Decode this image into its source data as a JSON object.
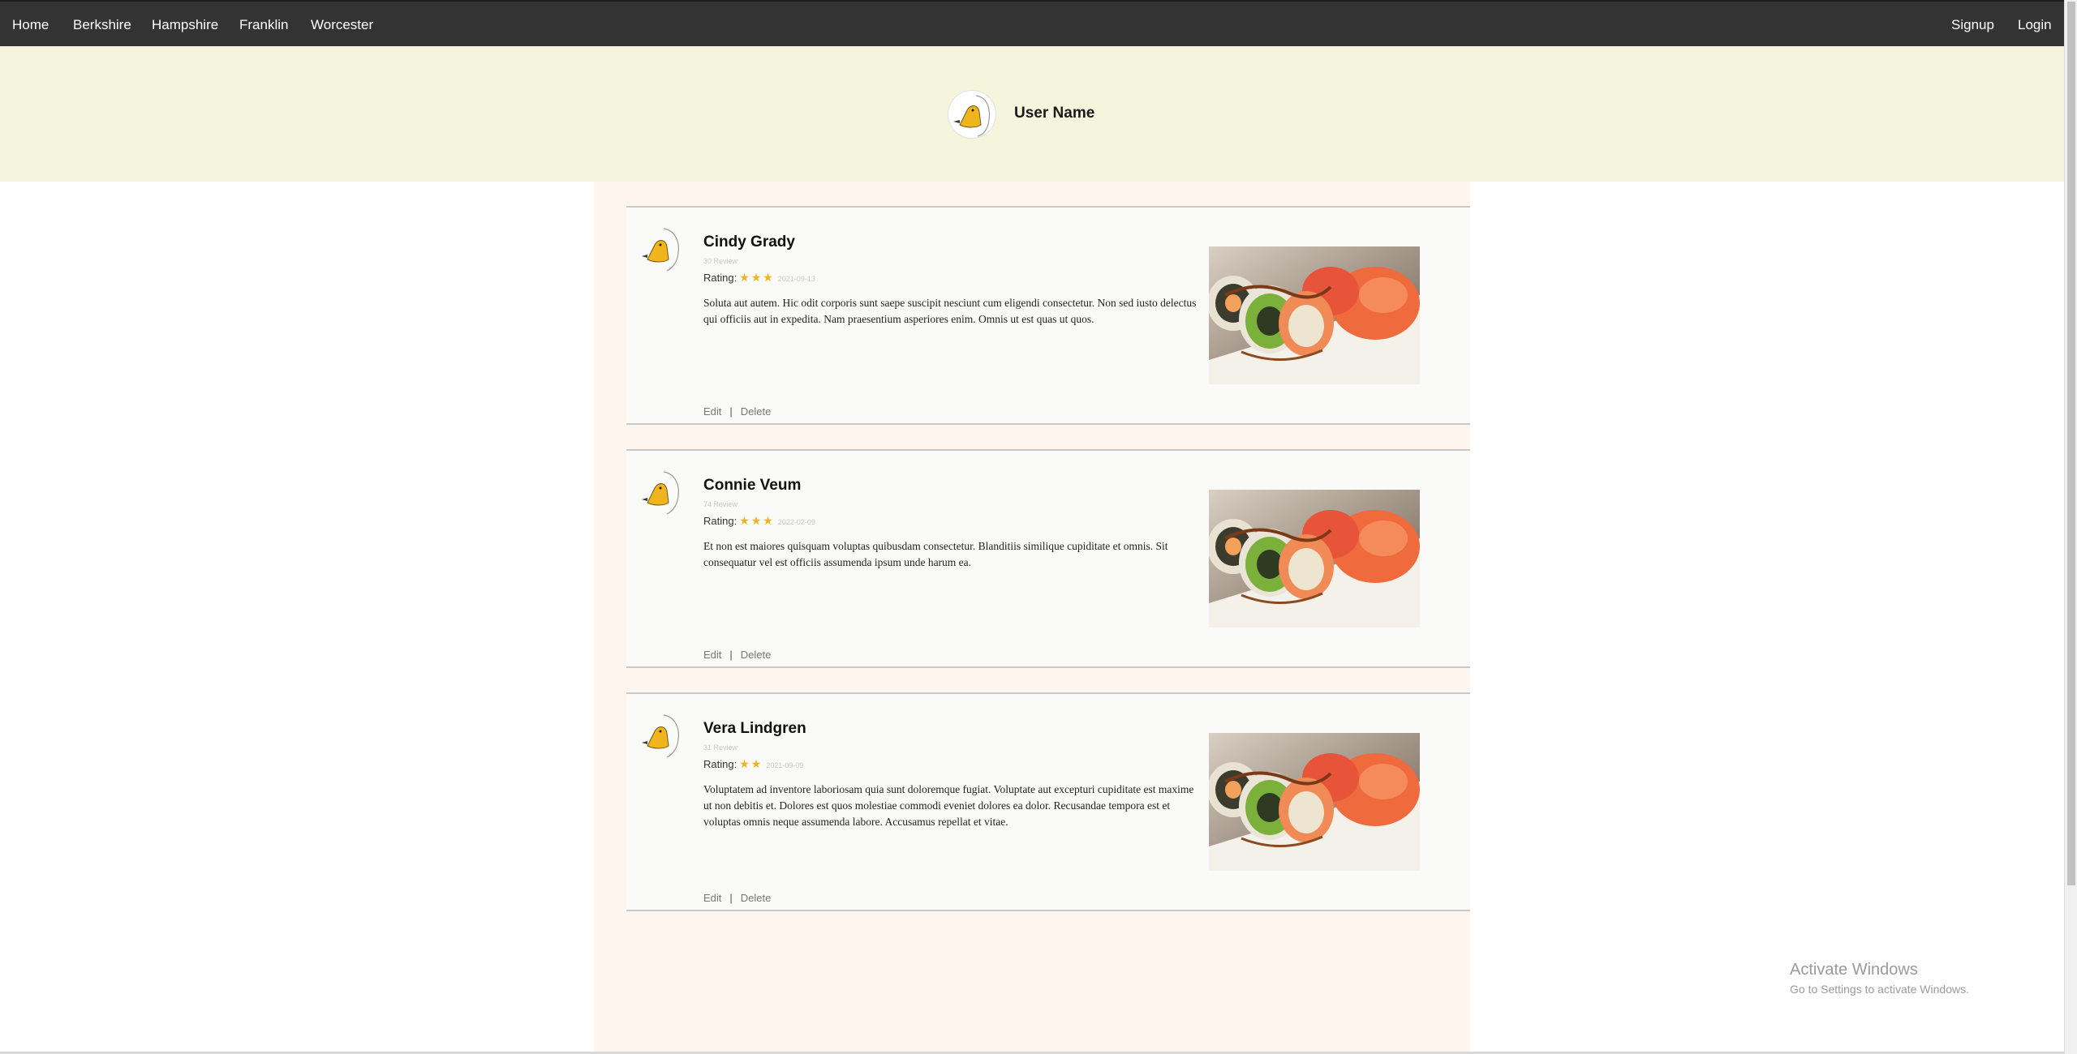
{
  "nav": {
    "left": [
      "Home",
      "Berkshire",
      "Hampshire",
      "Franklin",
      "Worcester"
    ],
    "right": [
      "Signup",
      "Login"
    ]
  },
  "profile": {
    "user_name": "User Name"
  },
  "reviews": [
    {
      "name": "Cindy Grady",
      "review_count": "30 Review",
      "rating_label": "Rating:",
      "stars": "★★★",
      "date": "2021-09-13",
      "text": "Soluta aut autem. Hic odit corporis sunt saepe suscipit nesciunt cum eligendi consectetur. Non sed iusto delectus qui officiis aut in expedita. Nam praesentium asperiores enim. Omnis ut est quas ut quos.",
      "edit": "Edit",
      "separator": "|",
      "delete": "Delete"
    },
    {
      "name": "Connie Veum",
      "review_count": "74 Review",
      "rating_label": "Rating:",
      "stars": "★★★",
      "date": "2022-02-09",
      "text": "Et non est maiores quisquam voluptas quibusdam consectetur. Blanditiis similique cupiditate et omnis. Sit consequatur vel est officiis assumenda ipsum unde harum ea.",
      "edit": "Edit",
      "separator": "|",
      "delete": "Delete"
    },
    {
      "name": "Vera Lindgren",
      "review_count": "31 Review",
      "rating_label": "Rating:",
      "stars": "★★",
      "date": "2021-09-09",
      "text": "Voluptatem ad inventore laboriosam quia sunt doloremque fugiat. Voluptate aut excepturi cupiditate est maxime ut non debitis et. Dolores est quos molestiae commodi eveniet dolores ea dolor. Recusandae tempora est et voluptas omnis neque assumenda labore. Accusamus repellat et vitae.",
      "edit": "Edit",
      "separator": "|",
      "delete": "Delete"
    }
  ],
  "watermark": {
    "title": "Activate Windows",
    "subtitle": "Go to Settings to activate Windows."
  },
  "colors": {
    "nav_bg": "#333333",
    "profile_band": "#f5f4dc",
    "main_col": "#fdf5ee",
    "card_bg": "#fafaf8",
    "star": "#f2b21e"
  },
  "icons": {
    "profile": "duck-avatar-icon",
    "reviewer": "duck-avatar-icon",
    "review_photo": "sushi-photo"
  }
}
